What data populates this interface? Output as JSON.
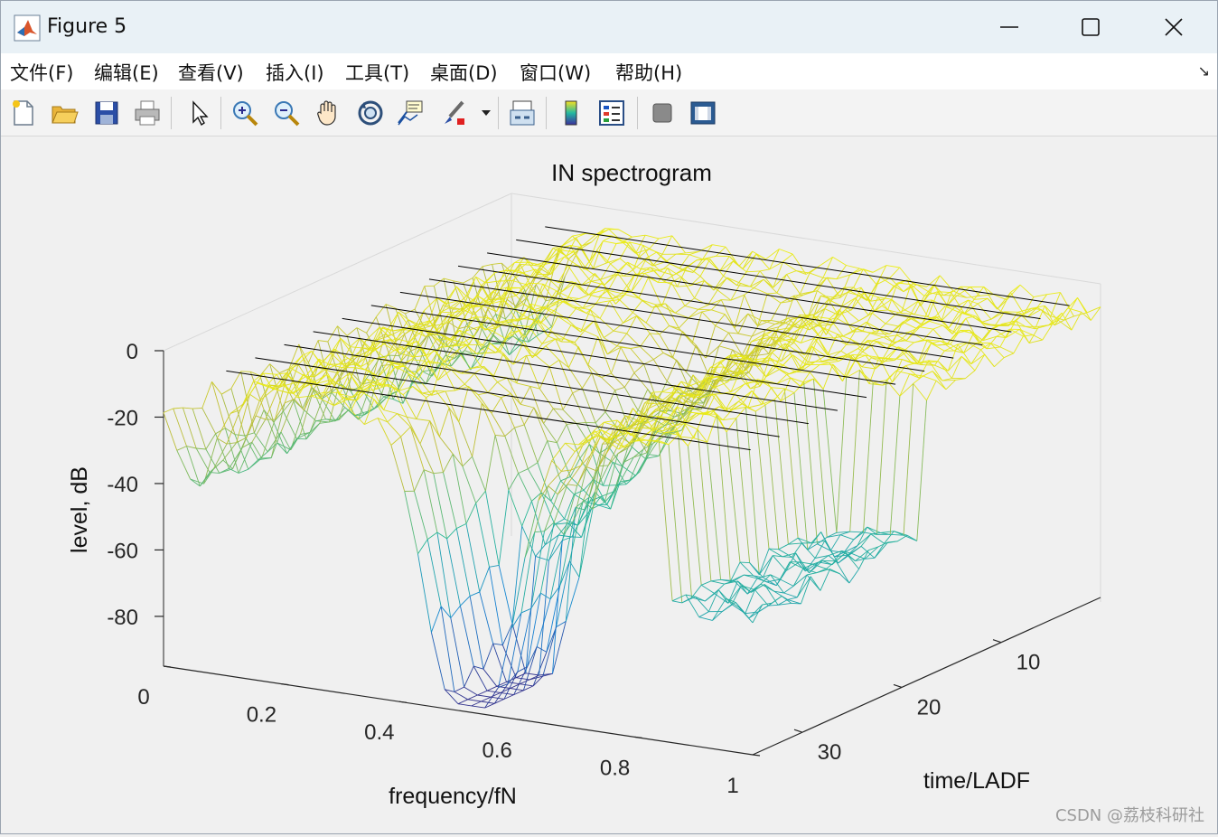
{
  "window": {
    "title": "Figure 5"
  },
  "menu": [
    {
      "label": "文件(F)"
    },
    {
      "label": "编辑(E)"
    },
    {
      "label": "查看(V)"
    },
    {
      "label": "插入(I)"
    },
    {
      "label": "工具(T)"
    },
    {
      "label": "桌面(D)"
    },
    {
      "label": "窗口(W)"
    },
    {
      "label": "帮助(H)"
    }
  ],
  "toolbar": [
    "new-figure-icon",
    "open-file-icon",
    "save-icon",
    "print-icon",
    "pointer-icon",
    "zoom-in-icon",
    "zoom-out-icon",
    "pan-hand-icon",
    "rotate-3d-icon",
    "data-cursor-icon",
    "brush-icon",
    "link-plot-icon",
    "colorbar-icon",
    "legend-icon",
    "hide-plot-tools-icon",
    "show-plot-tools-icon"
  ],
  "chart_data": {
    "type": "surface",
    "title": "IN spectrogram",
    "xlabel": "frequency/fN",
    "ylabel": "time/LADF",
    "zlabel": "level, dB",
    "x_ticks": [
      "0",
      "0.2",
      "0.4",
      "0.6",
      "0.8",
      "1"
    ],
    "y_ticks": [
      "10",
      "20",
      "30"
    ],
    "z_ticks": [
      "0",
      "-20",
      "-40",
      "-60",
      "-80"
    ],
    "xlim": [
      0,
      1
    ],
    "ylim": [
      0,
      35
    ],
    "zlim": [
      -95,
      0
    ],
    "colormap": "parula",
    "grid": true
  },
  "watermark": "CSDN @荔枝科研社"
}
